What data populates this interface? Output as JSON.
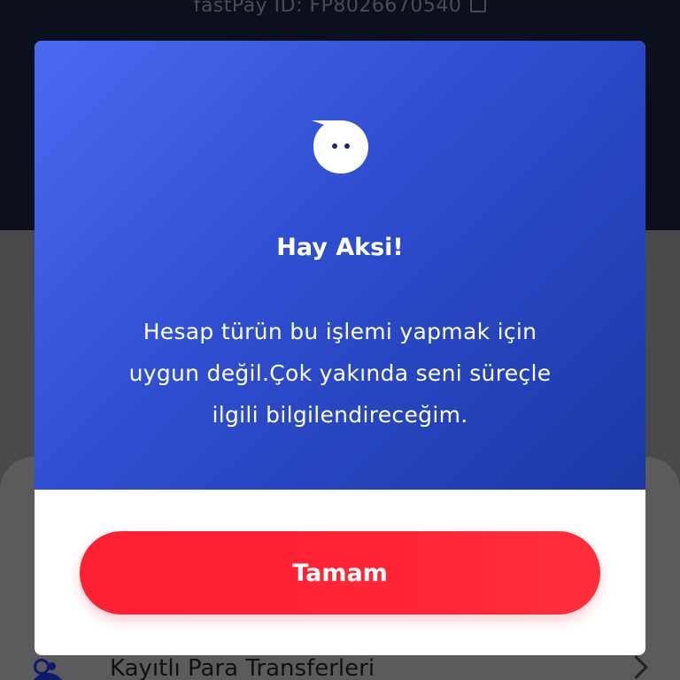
{
  "background": {
    "id_text": "fastPay ID: FP8026670540",
    "row_label": "Kayıtlı Para Transferleri"
  },
  "dialog": {
    "title": "Hay Aksi!",
    "message_line1": "Hesap türün bu işlemi yapmak için",
    "message_line2": "uygun değil.Çok yakında seni süreçle",
    "message_line3": "ilgili bilgilendireceğim.",
    "ok_label": "Tamam",
    "mascot_icon": "chat-bubble-face-icon"
  },
  "colors": {
    "dialog_gradient_start": "#4a6af2",
    "dialog_gradient_end": "#1c38a6",
    "button_red": "#ff2436",
    "text_white": "#ffffff"
  }
}
